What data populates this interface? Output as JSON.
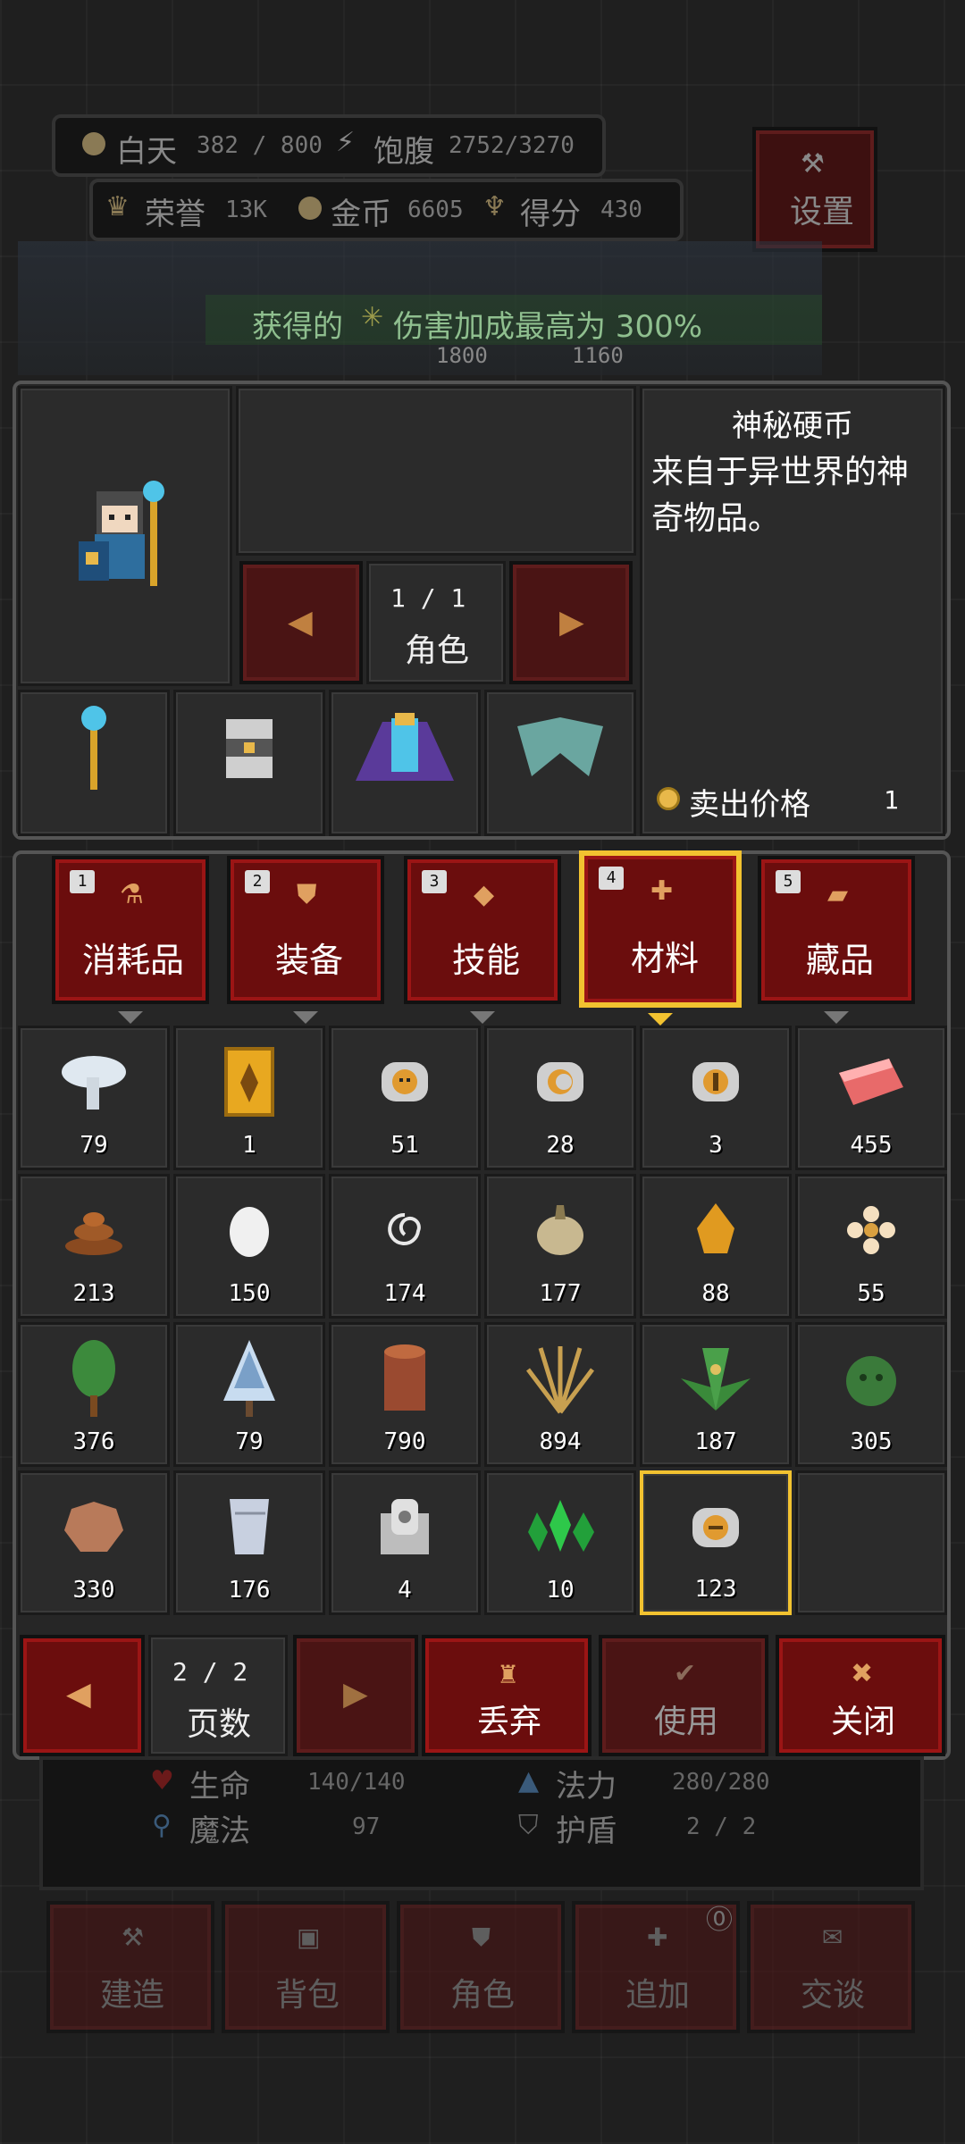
{
  "hud": {
    "day_label": "白天",
    "day_value": "382 / 800",
    "food_label": "饱腹",
    "food_value": "2752/3270",
    "honor_label": "荣誉",
    "honor_value": "13K",
    "gold_label": "金币",
    "gold_value": "6605",
    "score_label": "得分",
    "score_value": "430",
    "settings_label": "设置"
  },
  "banner": {
    "prefix": "获得的",
    "text": "伤害加成最高为 300%",
    "hp_left": "1800",
    "hp_right": "1160"
  },
  "character": {
    "page": "1 / 1",
    "page_label": "角色"
  },
  "item_info": {
    "name": "神秘硬币",
    "desc_line1": "来自于异世界的神",
    "desc_line2": "奇物品。",
    "sell_label": "卖出价格",
    "sell_value": "1"
  },
  "tabs": [
    {
      "key": "1",
      "label": "消耗品"
    },
    {
      "key": "2",
      "label": "装备"
    },
    {
      "key": "3",
      "label": "技能"
    },
    {
      "key": "4",
      "label": "材料"
    },
    {
      "key": "5",
      "label": "藏品"
    }
  ],
  "items": [
    {
      "icon": "mushroom-icon",
      "count": "79"
    },
    {
      "icon": "golden-card-icon",
      "count": "1"
    },
    {
      "icon": "coin-skull-icon",
      "count": "51"
    },
    {
      "icon": "coin-moon-icon",
      "count": "28"
    },
    {
      "icon": "coin-anchor-icon",
      "count": "3"
    },
    {
      "icon": "raw-meat-icon",
      "count": "455"
    },
    {
      "icon": "dung-icon",
      "count": "213"
    },
    {
      "icon": "egg-icon",
      "count": "150"
    },
    {
      "icon": "string-icon",
      "count": "174"
    },
    {
      "icon": "onion-icon",
      "count": "177"
    },
    {
      "icon": "amber-icon",
      "count": "88"
    },
    {
      "icon": "flower-icon",
      "count": "55"
    },
    {
      "icon": "tree-icon",
      "count": "376"
    },
    {
      "icon": "snow-tree-icon",
      "count": "79"
    },
    {
      "icon": "log-icon",
      "count": "790"
    },
    {
      "icon": "wheat-icon",
      "count": "894"
    },
    {
      "icon": "herb-icon",
      "count": "187"
    },
    {
      "icon": "cactus-icon",
      "count": "305"
    },
    {
      "icon": "leather-icon",
      "count": "330"
    },
    {
      "icon": "cloth-icon",
      "count": "176"
    },
    {
      "icon": "stone-icon",
      "count": "4"
    },
    {
      "icon": "emerald-icon",
      "count": "10"
    },
    {
      "icon": "coin-face-icon",
      "count": "123"
    },
    {
      "icon": "",
      "count": ""
    }
  ],
  "bottom": {
    "page": "2 / 2",
    "page_label": "页数",
    "discard": "丢弃",
    "use": "使用",
    "close": "关闭"
  },
  "stats": {
    "hp_label": "生命",
    "hp_value": "140/140",
    "mp_label": "法力",
    "mp_value": "280/280",
    "magic_label": "魔法",
    "magic_value": "97",
    "shield_label": "护盾",
    "shield_value": "2 / 2"
  },
  "nav": [
    "建造",
    "背包",
    "角色",
    "追加",
    "交谈"
  ],
  "colors": {
    "accent_red": "#6b0d0d",
    "selected_gold": "#f2c230"
  }
}
